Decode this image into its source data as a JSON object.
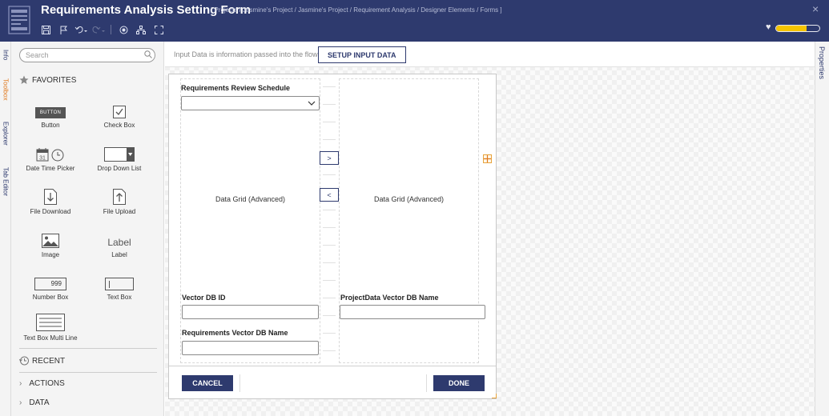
{
  "header": {
    "title": "Requirements Analysis Setting Form",
    "breadcrumb": "[ Projects / Jasmine's Project / Jasmine's Project / Requirement Analysis / Designer Elements / Forms ]",
    "close_icon": "×",
    "progress_fraction": 0.7,
    "progress_color": "#f5c400",
    "toolbar_icons": [
      "save-icon",
      "flag-icon",
      "undo-icon",
      "redo-icon",
      "view-icon",
      "hierarchy-icon",
      "expand-icon"
    ]
  },
  "left_tabs": [
    "Info",
    "Toolbox",
    "Explorer",
    "Tab Editor"
  ],
  "toolbox": {
    "search_placeholder": "Search",
    "favorites_label": "FAVORITES",
    "items": [
      {
        "label": "Button",
        "icon_text": "BUTTON"
      },
      {
        "label": "Check Box"
      },
      {
        "label": "Date Time Picker",
        "icon_text": "31"
      },
      {
        "label": "Drop Down List"
      },
      {
        "label": "File Download"
      },
      {
        "label": "File Upload"
      },
      {
        "label": "Image"
      },
      {
        "label": "Label",
        "icon_text": "Label"
      },
      {
        "label": "Number Box",
        "icon_text": "999"
      },
      {
        "label": "Text Box"
      },
      {
        "label": "Text Box Multi Line"
      }
    ],
    "recent_label": "RECENT",
    "tree": [
      {
        "label": "ACTIONS"
      },
      {
        "label": "DATA"
      }
    ]
  },
  "input_bar": {
    "text": "Input Data is information passed into the flow",
    "setup_button": "SETUP INPUT DATA"
  },
  "form": {
    "dropdown_label": "Requirements Review Schedule",
    "left_grid_label": "Data Grid (Advanced)",
    "right_grid_label": "Data Grid (Advanced)",
    "move_right_label": ">",
    "move_left_label": "<",
    "vector_db_id_label": "Vector DB ID",
    "project_vector_label": "ProjectData Vector DB Name",
    "requirements_vector_label": "Requirements Vector DB Name",
    "cancel_button": "CANCEL",
    "done_button": "DONE"
  },
  "properties_tab": "Properties",
  "colors": {
    "header_bg": "#2e3a6e",
    "accent": "#e07a1f",
    "primary_button": "#2e3a6e"
  }
}
